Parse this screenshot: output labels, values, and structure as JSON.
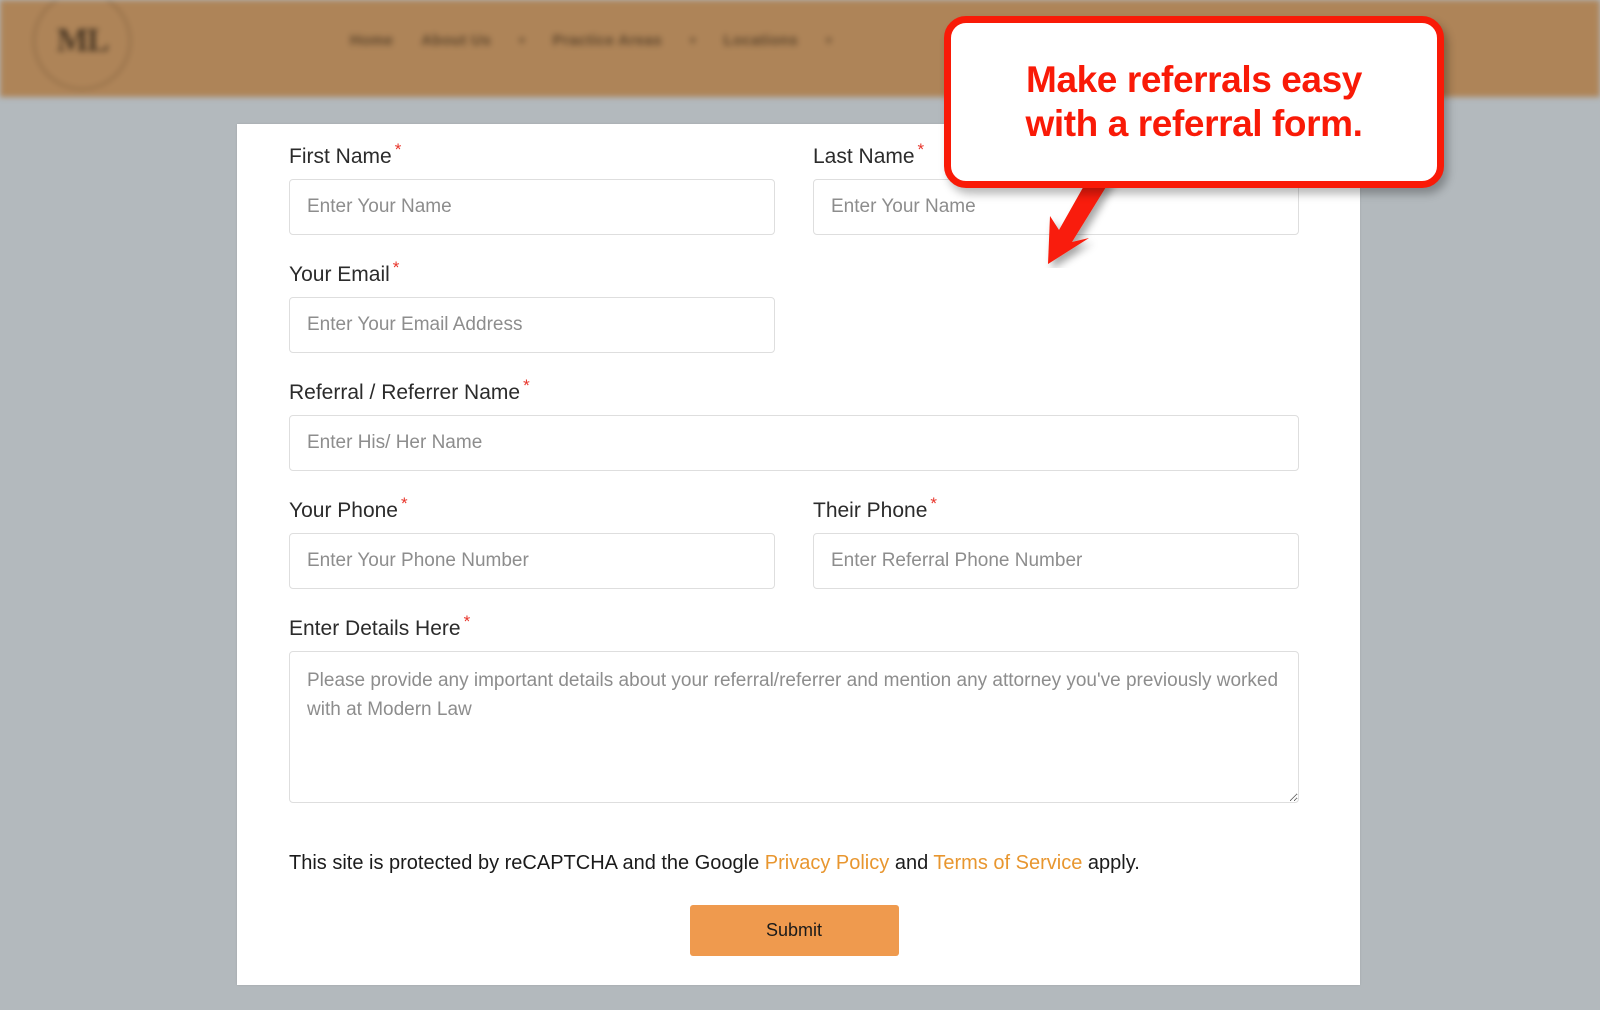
{
  "site_header": {
    "logo_text": "ML",
    "logo_icon": "circular-monogram-logo",
    "nav_items": [
      {
        "label": "Home",
        "has_caret": false
      },
      {
        "label": "About Us",
        "has_caret": true
      },
      {
        "label": "Practice Areas",
        "has_caret": true
      },
      {
        "label": "Locations",
        "has_caret": true
      }
    ],
    "caret_glyph": "▾"
  },
  "annotation": {
    "text": "Make referrals easy\nwith a referral form.",
    "border_color": "#f91a07",
    "text_color": "#f91a07",
    "arrow_icon": "down-left-arrow-icon"
  },
  "form": {
    "fields": {
      "first_name": {
        "label": "First Name",
        "required_mark": "*",
        "placeholder": "Enter Your Name",
        "value": ""
      },
      "last_name": {
        "label": "Last Name",
        "required_mark": "*",
        "placeholder": "Enter Your Name",
        "value": ""
      },
      "email": {
        "label": "Your Email",
        "required_mark": "*",
        "placeholder": "Enter Your Email Address",
        "value": ""
      },
      "referral_name": {
        "label": "Referral / Referrer Name",
        "required_mark": "*",
        "placeholder": "Enter His/ Her Name",
        "value": ""
      },
      "your_phone": {
        "label": "Your Phone",
        "required_mark": "*",
        "placeholder": "Enter Your Phone Number",
        "value": ""
      },
      "their_phone": {
        "label": "Their Phone",
        "required_mark": "*",
        "placeholder": "Enter Referral Phone Number",
        "value": ""
      },
      "details": {
        "label": "Enter Details Here",
        "required_mark": "*",
        "placeholder": "Please provide any important details about your referral/referrer and mention any attorney you've previously worked with at Modern Law",
        "value": ""
      }
    },
    "recaptcha": {
      "prefix": "This site is protected by reCAPTCHA and the Google ",
      "privacy_link": "Privacy Policy",
      "middle": " and ",
      "terms_link": "Terms of Service",
      "suffix": " apply."
    },
    "submit_label": "Submit"
  },
  "colors": {
    "page_background": "#b3b9bd",
    "header_band": "#ae8458",
    "card_background": "#ffffff",
    "accent_orange": "#ef9a4e",
    "link_orange": "#e8962f",
    "required_red": "#e8342a",
    "annotation_red": "#f91a07"
  }
}
